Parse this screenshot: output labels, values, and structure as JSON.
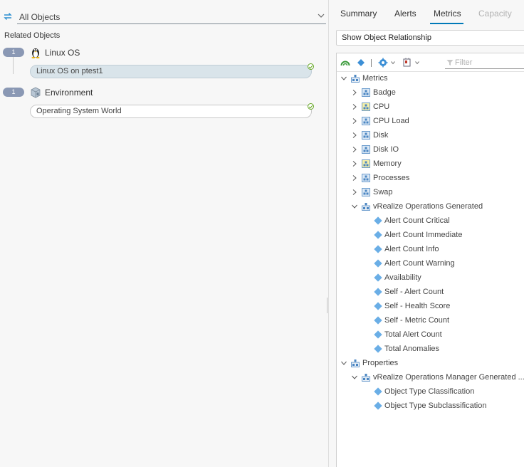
{
  "left": {
    "scope_select": "All Objects",
    "related_title": "Related Objects",
    "groups": [
      {
        "count": "1",
        "label": "Linux OS",
        "icon": "linux-penguin-icon",
        "object": "Linux OS on ptest1",
        "selected": true
      },
      {
        "count": "1",
        "label": "Environment",
        "icon": "environment-cube-icon",
        "object": "Operating System World",
        "selected": false
      }
    ]
  },
  "tabs": [
    {
      "label": "Summary",
      "state": "normal"
    },
    {
      "label": "Alerts",
      "state": "normal"
    },
    {
      "label": "Metrics",
      "state": "active"
    },
    {
      "label": "Capacity",
      "state": "disabled"
    }
  ],
  "relationship_button": "Show Object Relationship",
  "filter": {
    "placeholder": "Filter"
  },
  "tree": [
    {
      "label": "Metrics",
      "kind": "group",
      "level": 0,
      "expanded": true
    },
    {
      "label": "Badge",
      "kind": "folder",
      "level": 1,
      "expanded": false
    },
    {
      "label": "CPU",
      "kind": "folder-yellow",
      "level": 1,
      "expanded": false
    },
    {
      "label": "CPU Load",
      "kind": "folder",
      "level": 1,
      "expanded": false
    },
    {
      "label": "Disk",
      "kind": "folder",
      "level": 1,
      "expanded": false
    },
    {
      "label": "Disk IO",
      "kind": "folder",
      "level": 1,
      "expanded": false
    },
    {
      "label": "Memory",
      "kind": "folder-yellow",
      "level": 1,
      "expanded": false
    },
    {
      "label": "Processes",
      "kind": "folder",
      "level": 1,
      "expanded": false
    },
    {
      "label": "Swap",
      "kind": "folder",
      "level": 1,
      "expanded": false
    },
    {
      "label": "vRealize Operations Generated",
      "kind": "group",
      "level": 1,
      "expanded": true
    },
    {
      "label": "Alert Count Critical",
      "kind": "metric",
      "level": 2
    },
    {
      "label": "Alert Count Immediate",
      "kind": "metric",
      "level": 2
    },
    {
      "label": "Alert Count Info",
      "kind": "metric",
      "level": 2
    },
    {
      "label": "Alert Count Warning",
      "kind": "metric",
      "level": 2
    },
    {
      "label": "Availability",
      "kind": "metric",
      "level": 2
    },
    {
      "label": "Self - Alert Count",
      "kind": "metric",
      "level": 2
    },
    {
      "label": "Self - Health Score",
      "kind": "metric",
      "level": 2
    },
    {
      "label": "Self - Metric Count",
      "kind": "metric",
      "level": 2
    },
    {
      "label": "Total Alert Count",
      "kind": "metric",
      "level": 2
    },
    {
      "label": "Total Anomalies",
      "kind": "metric",
      "level": 2
    },
    {
      "label": "Properties",
      "kind": "group",
      "level": 0,
      "expanded": true
    },
    {
      "label": "vRealize Operations Manager Generated ...",
      "kind": "group",
      "level": 1,
      "expanded": true
    },
    {
      "label": "Object Type Classification",
      "kind": "metric",
      "level": 2
    },
    {
      "label": "Object Type Subclassification",
      "kind": "metric",
      "level": 2
    }
  ],
  "colors": {
    "accent": "#0079b8",
    "pill": "#8a98b4",
    "diamond": "#6aaee6",
    "check": "#62a420"
  }
}
